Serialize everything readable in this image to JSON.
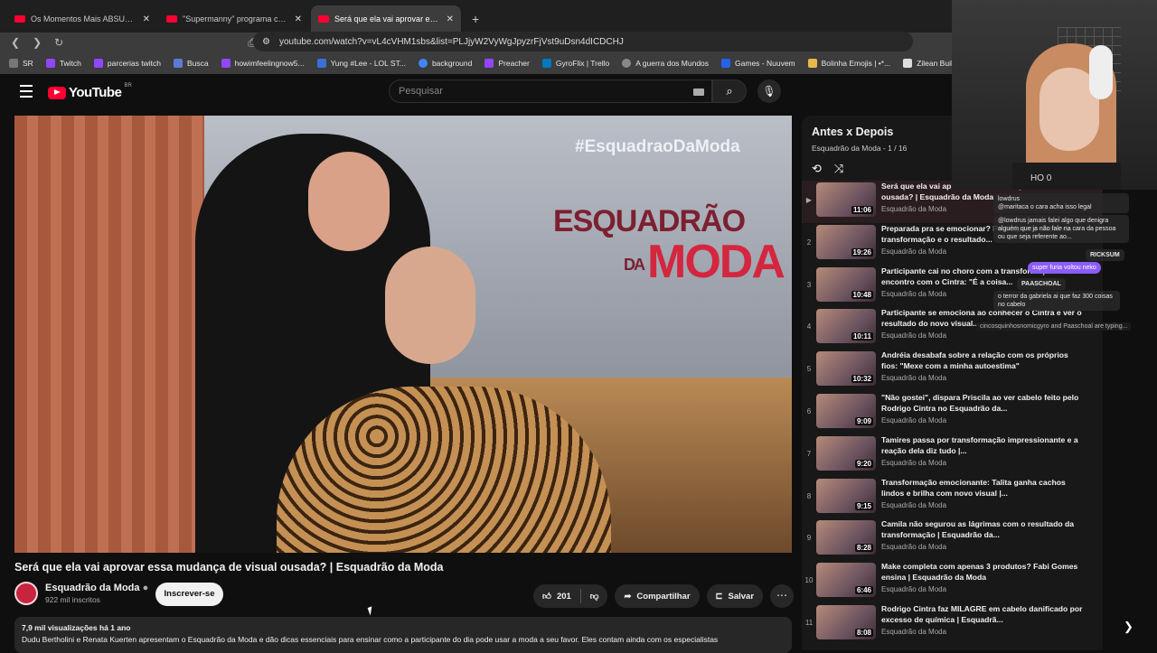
{
  "browser": {
    "tabs": [
      {
        "label": "Os Momentos Mais ABSURDOS do E"
      },
      {
        "label": "\"Supermanny\" programa completo -"
      },
      {
        "label": "Será que ela vai aprovar essa"
      }
    ],
    "url": "youtube.com/watch?v=vL4cVHM1sbs&list=PLJjyW2VyWgJpyzrFjVst9uDsn4dICDCHJ",
    "bookmarks": [
      "SR",
      "Twitch",
      "parcerias twitch",
      "Busca",
      "howimfeelingnow5...",
      "Yung #Lee - LOL ST...",
      "background",
      "Preacher",
      "GyroFlix | Trello",
      "A guerra dos Mundos",
      "Games - Nuuvem",
      "Bolinha Emojis | •*...",
      "Zilean Build"
    ]
  },
  "youtube": {
    "logo_text": "YouTube",
    "region": "BR",
    "search_placeholder": "Pesquisar"
  },
  "video": {
    "overlay_hashtag": "#EsquadraoDaModa",
    "overlay_brand_top": "ESQUADRÃO",
    "overlay_brand_da": "DA",
    "overlay_brand_bottom": "MODA",
    "title": "Será que ela vai aprovar essa mudança de visual ousada? | Esquadrão da Moda",
    "channel": "Esquadrão da Moda",
    "subscribers": "922 mil inscritos",
    "subscribe_label": "Inscrever-se",
    "likes": "201",
    "share_label": "Compartilhar",
    "save_label": "Salvar",
    "views_line": "7,9 mil visualizações  há 1 ano",
    "description": "Dudu Bertholini e Renata Kuerten apresentam o Esquadrão da Moda e dão dicas essenciais para ensinar como a participante do dia pode usar a moda a seu favor. Eles contam ainda com os especialistas"
  },
  "playlist": {
    "title": "Antes x Depois",
    "subtitle": "Esquadrão da Moda - 1 / 16",
    "items": [
      {
        "index": "▶",
        "title": "Será que ela vai aprovar essa mudança de visual ousada? | Esquadrão da Moda",
        "channel": "Esquadrão da Moda",
        "duration": "11:06"
      },
      {
        "index": "2",
        "title": "Preparada pra se emocionar? Participante chora na transformação e o resultado...",
        "channel": "Esquadrão da Moda",
        "duration": "19:26"
      },
      {
        "index": "3",
        "title": "Participante cai no choro com a transformação e o encontro com o Cintra: \"É a coisa...",
        "channel": "Esquadrão da Moda",
        "duration": "10:48"
      },
      {
        "index": "4",
        "title": "Participante se emociona ao conhecer o Cintra e ver o resultado do novo visual...",
        "channel": "Esquadrão da Moda",
        "duration": "10:11"
      },
      {
        "index": "5",
        "title": "Andréia desabafa sobre a relação com os próprios fios: \"Mexe com a minha autoestima\"",
        "channel": "Esquadrão da Moda",
        "duration": "10:32"
      },
      {
        "index": "6",
        "title": "\"Não gostei\", dispara Priscila ao ver cabelo feito pelo Rodrigo Cintra no Esquadrão da...",
        "channel": "Esquadrão da Moda",
        "duration": "9:09"
      },
      {
        "index": "7",
        "title": "Tamires passa por transformação impressionante e a reação dela diz tudo |...",
        "channel": "Esquadrão da Moda",
        "duration": "9:20"
      },
      {
        "index": "8",
        "title": "Transformação emocionante: Talita ganha cachos lindos e brilha com novo visual |...",
        "channel": "Esquadrão da Moda",
        "duration": "9:15"
      },
      {
        "index": "9",
        "title": "Camila não segurou as lágrimas com o resultado da transformação | Esquadrão da...",
        "channel": "Esquadrão da Moda",
        "duration": "8:28"
      },
      {
        "index": "10",
        "title": "Make completa com apenas 3 produtos? Fabi Gomes ensina | Esquadrão da Moda",
        "channel": "Esquadrão da Moda",
        "duration": "6:46"
      },
      {
        "index": "11",
        "title": "Rodrigo Cintra faz MILAGRE em cabelo danificado por excesso de química | Esquadrã...",
        "channel": "Esquadrão da Moda",
        "duration": "8:08"
      }
    ]
  },
  "stream_overlay": {
    "shirt_text": "HO 0",
    "chat": [
      {
        "text": "lowdrus\n@maritaca o cara acha isso legal"
      },
      {
        "text": "@lowdrus jamais falei algo que denigra alguém que ja não fale na cara da pessoa ou que seja referente ao..."
      },
      {
        "text": "RICKSUM"
      },
      {
        "text": "super furia voltou neko"
      },
      {
        "text": "PAASCHOAL"
      },
      {
        "text": "o terror da gabriela ai que faz 300 coisas no cabelo"
      }
    ],
    "typing": "cincosquinhosnomicgyro and Paaschoal are typing..."
  },
  "colors": {
    "accent": "#ff0033",
    "brand_red": "#d4263f",
    "background": "#0f0f0f"
  }
}
